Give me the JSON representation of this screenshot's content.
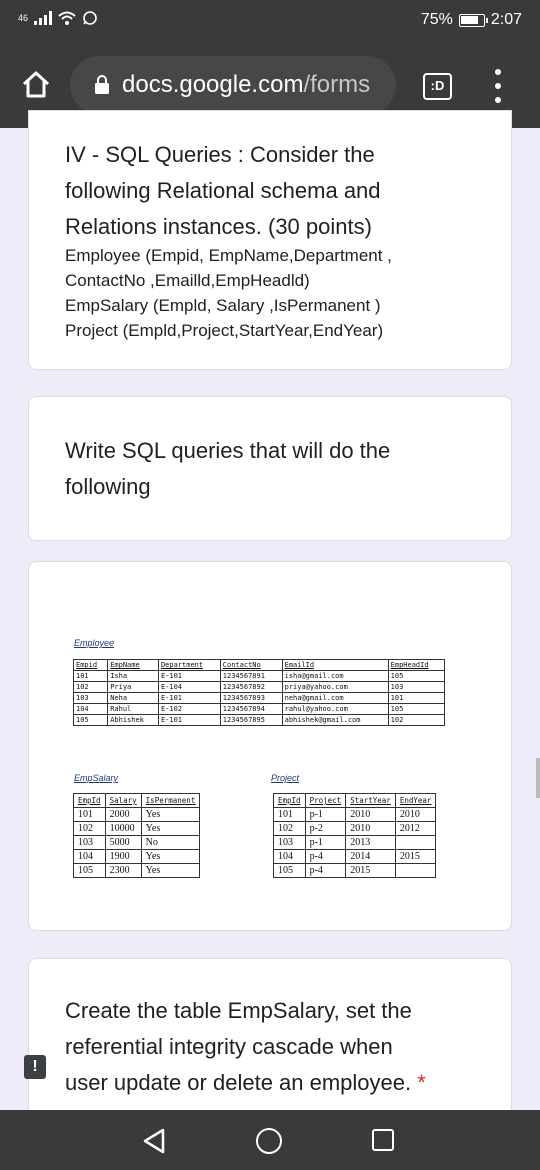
{
  "status_bar": {
    "network": "46",
    "battery": "75%",
    "time": "2:07"
  },
  "browser": {
    "url_domain": "docs.google.com",
    "url_path": "/forms",
    "tab_label": ":D"
  },
  "question1": {
    "title_lines": [
      "IV - SQL Queries : Consider the",
      "following Relational schema and",
      "Relations instances. (30 points)"
    ],
    "body_lines": [
      "Employee (Empid, EmpName,Department ,",
      "ContactNo ,Emailld,EmpHeadld)",
      "EmpSalary (Empld, Salary ,IsPermanent )",
      "Project (Empld,Project,StartYear,EndYear)"
    ]
  },
  "question2": {
    "title_lines": [
      "Write SQL queries that will do the",
      "following"
    ]
  },
  "image": {
    "employee_label": "Employee",
    "employee_table": [
      [
        "Empid",
        "EmpName",
        "Department",
        "ContactNo",
        "EmailId",
        "EmpHeadId"
      ],
      [
        "101",
        "Isha",
        "E-101",
        "1234567891",
        "isha@gmail.com",
        "105"
      ],
      [
        "102",
        "Priya",
        "E-104",
        "1234567892",
        "priya@yahoo.com",
        "103"
      ],
      [
        "103",
        "Neha",
        "E-101",
        "1234567893",
        "neha@gmail.com",
        "101"
      ],
      [
        "104",
        "Rahul",
        "E-102",
        "1234567894",
        "rahul@yahoo.com",
        "105"
      ],
      [
        "105",
        "Abhishek",
        "E-101",
        "1234567895",
        "abhishek@gmail.com",
        "102"
      ]
    ],
    "empsalary_label": "EmpSalary",
    "empsalary_table": [
      [
        "EmpId",
        "Salary",
        "IsPermanent"
      ],
      [
        "101",
        "2000",
        "Yes"
      ],
      [
        "102",
        "10000",
        "Yes"
      ],
      [
        "103",
        "5000",
        "No"
      ],
      [
        "104",
        "1900",
        "Yes"
      ],
      [
        "105",
        "2300",
        "Yes"
      ]
    ],
    "project_label": "Project",
    "project_table": [
      [
        "EmpId",
        "Project",
        "StartYear",
        "EndYear"
      ],
      [
        "101",
        "p-1",
        "2010",
        "2010"
      ],
      [
        "102",
        "p-2",
        "2010",
        "2012"
      ],
      [
        "103",
        "p-1",
        "2013",
        ""
      ],
      [
        "104",
        "p-4",
        "2014",
        "2015"
      ],
      [
        "105",
        "p-4",
        "2015",
        ""
      ]
    ]
  },
  "question3": {
    "title_lines": [
      "Create the table EmpSalary, set the",
      "referential integrity cascade when",
      "user update or delete an employee."
    ],
    "required_mark": "*"
  },
  "side_indicator": "!"
}
